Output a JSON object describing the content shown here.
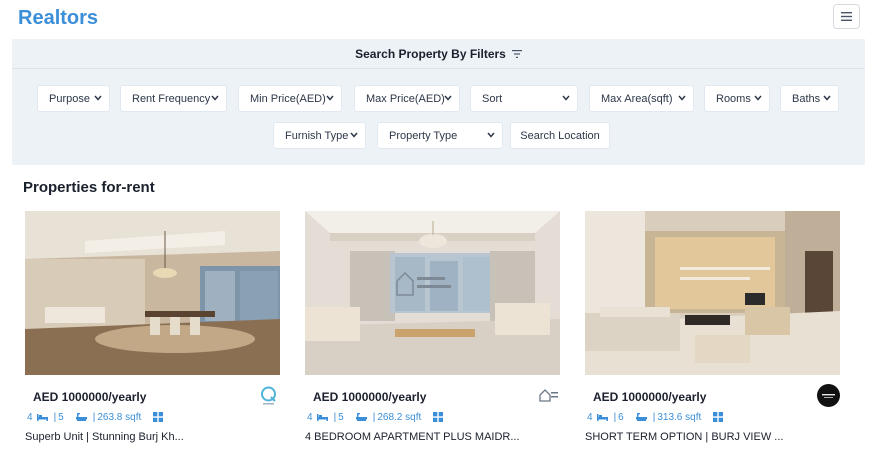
{
  "app": {
    "brand": "Realtors",
    "menu_icon": "hamburger-icon"
  },
  "filters": {
    "header": "Search Property By Filters",
    "header_icon": "filter-icon",
    "row1": [
      "Purpose",
      "Rent Frequency",
      "Min Price(AED)",
      "Max Price(AED)",
      "Sort",
      "Max Area(sqft)",
      "Rooms",
      "Baths"
    ],
    "row2": [
      "Furnish Type",
      "Property Type"
    ],
    "search_location": "Search Location"
  },
  "section": {
    "title": "Properties for-rent"
  },
  "listings": [
    {
      "price": "AED 1000000/yearly",
      "rooms": "4",
      "baths": "5",
      "area": "263.8 sqft",
      "title": "Superb Unit | Stunning Burj Kh...",
      "agency_logo": "agency-logo-q"
    },
    {
      "price": "AED 1000000/yearly",
      "rooms": "4",
      "baths": "5",
      "area": "268.2 sqft",
      "title": "4 BEDROOM APARTMENT PLUS MAIDR...",
      "agency_logo": "agency-logo-icon-homes"
    },
    {
      "price": "AED 1000000/yearly",
      "rooms": "4",
      "baths": "6",
      "area": "313.6 sqft",
      "title": "SHORT TERM OPTION | BURJ VIEW ...",
      "agency_logo": "agency-logo-whitehaven"
    }
  ],
  "colors": {
    "brand": "#3b8fd9",
    "panel": "#edf2f7",
    "text": "#1a202c"
  }
}
